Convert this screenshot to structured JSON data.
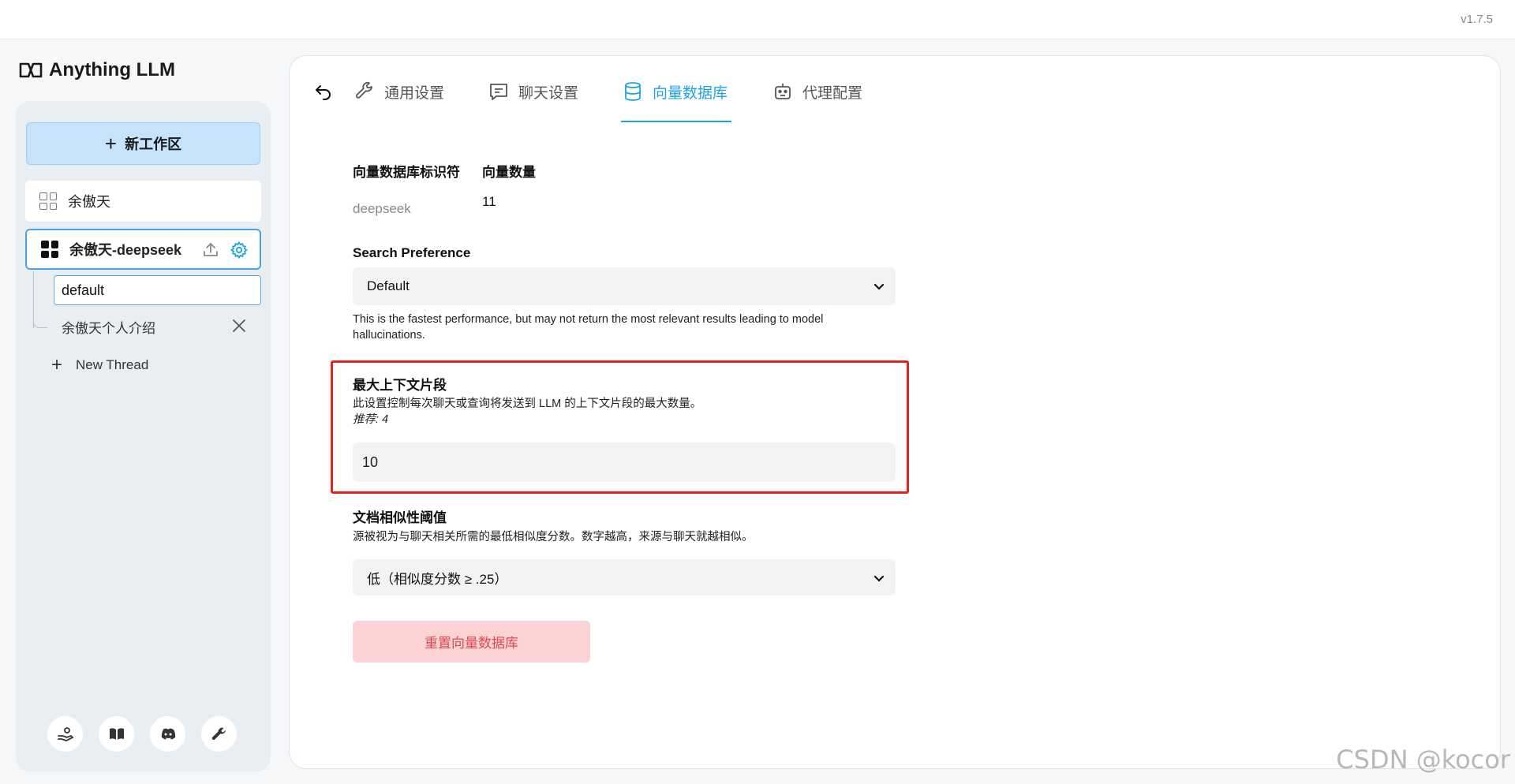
{
  "version": "v1.7.5",
  "app": {
    "name": "Anything LLM"
  },
  "sidebar": {
    "new_workspace_label": "新工作区",
    "workspaces": [
      {
        "label": "余傲天"
      },
      {
        "label": "余傲天-deepseek"
      }
    ],
    "threads": [
      {
        "label": "default"
      },
      {
        "label": "余傲天个人介绍"
      }
    ],
    "new_thread_label": "New Thread",
    "footer_icons": [
      "support-icon",
      "docs-book-icon",
      "discord-icon",
      "settings-wrench-icon"
    ]
  },
  "tabs": [
    {
      "label": "通用设置",
      "icon": "wrench-icon"
    },
    {
      "label": "聊天设置",
      "icon": "chat-icon"
    },
    {
      "label": "向量数据库",
      "icon": "database-icon",
      "active": true
    },
    {
      "label": "代理配置",
      "icon": "robot-icon"
    }
  ],
  "vector_db": {
    "identifier_label": "向量数据库标识符",
    "identifier_value": "deepseek",
    "count_label": "向量数量",
    "count_value": "11"
  },
  "search_preference": {
    "label": "Search Preference",
    "selected": "Default",
    "help": "This is the fastest performance, but may not return the most relevant results leading to model hallucinations."
  },
  "max_context": {
    "label": "最大上下文片段",
    "help": "此设置控制每次聊天或查询将发送到 LLM 的上下文片段的最大数量。",
    "recommend": "推荐: 4",
    "value": "10"
  },
  "similarity": {
    "label": "文档相似性阈值",
    "help": "源被视为与聊天相关所需的最低相似度分数。数字越高，来源与聊天就越相似。",
    "selected": "低（相似度分数 ≥ .25）"
  },
  "reset_label": "重置向量数据库",
  "watermark": "CSDN @kocor",
  "colors": {
    "accent": "#1fa2e6",
    "highlight_border": "#e3231c",
    "danger_bg": "#fcd3d5",
    "danger_text": "#e0484f"
  }
}
